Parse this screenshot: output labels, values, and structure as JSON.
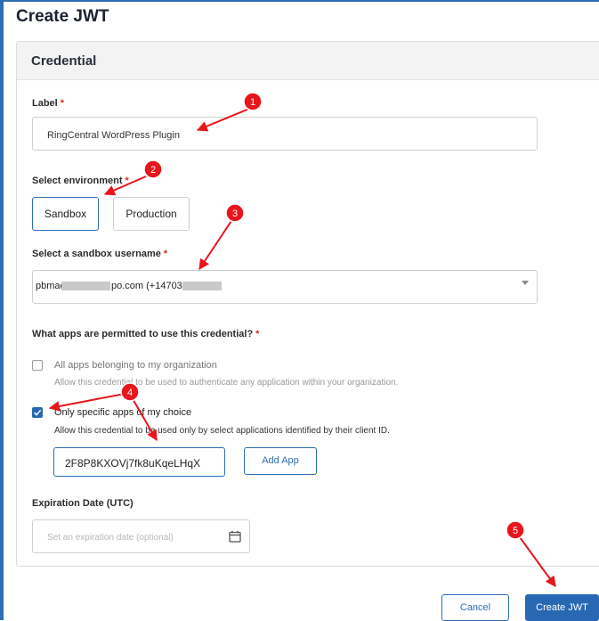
{
  "page": {
    "title": "Create JWT"
  },
  "card": {
    "header": "Credential"
  },
  "label_field": {
    "label": "Label",
    "required": "*",
    "value": "RingCentral WordPress Plugin"
  },
  "environment": {
    "label": "Select environment",
    "required": "*",
    "options": [
      "Sandbox",
      "Production"
    ],
    "selected": "Sandbox"
  },
  "sandbox_user": {
    "label": "Select a sandbox username",
    "required": "*",
    "value_prefix": "pbmac",
    "value_middle": "po.com (+14703"
  },
  "apps": {
    "question": "What apps are permitted to use this credential?",
    "required": "*",
    "option_all": {
      "title": "All apps belonging to my organization",
      "description": "Allow this credential to be used to authenticate any application within your organization.",
      "checked": false
    },
    "option_specific": {
      "title": "Only specific apps of my choice",
      "description": "Allow this credential to be used only by select applications identified by their client ID.",
      "checked": true
    },
    "client_id": "2F8P8KXOVj7fk8uKqeLHqX",
    "add_button": "Add App"
  },
  "expiration": {
    "label": "Expiration Date (UTC)",
    "placeholder": "Set an expiration date (optional)"
  },
  "actions": {
    "cancel": "Cancel",
    "create": "Create JWT"
  },
  "annotations": [
    "1",
    "2",
    "3",
    "4",
    "5"
  ],
  "colors": {
    "accent": "#2868b3",
    "annotation": "#e8151b",
    "required": "#d93025"
  },
  "icons": {
    "calendar": "calendar-icon",
    "checkmark": "check-icon",
    "dropdown": "chevron-down-icon"
  }
}
